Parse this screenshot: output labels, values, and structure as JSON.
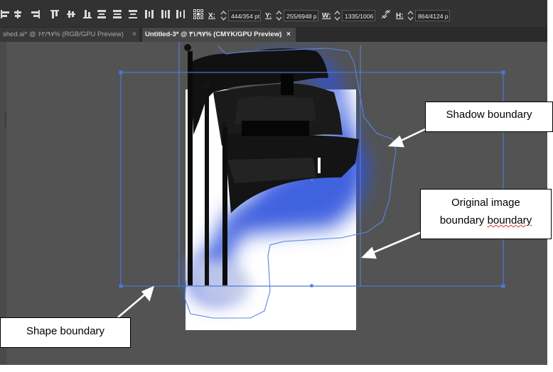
{
  "toolbar": {
    "align_icons": [
      "align-left-icon",
      "align-horizontal-center-icon",
      "align-right-icon",
      "align-top-icon",
      "align-vertical-center-icon",
      "align-bottom-icon",
      "distribute-top-icon",
      "distribute-vertical-center-icon",
      "distribute-bottom-icon",
      "distribute-left-icon",
      "distribute-horizontal-center-icon",
      "distribute-right-icon"
    ],
    "reference_point_icon": "reference-point-icon",
    "x_label": "X:",
    "x_value": "444/354 pt",
    "y_label": "Y:",
    "y_value": "255/6948 p",
    "w_label": "W:",
    "w_value": "1335/1006",
    "link_icon": "constrain-proportions-icon",
    "h_label": "H:",
    "h_value": "864/4124 p"
  },
  "tabs": [
    {
      "label": "shed.ai* @ ۶۲/۹۷% (RGB/GPU Preview)",
      "close": "×",
      "active": false
    },
    {
      "label": "Untitled-3* @ ۳۱/۹۷% (CMYK/GPU Preview)",
      "close": "×",
      "active": true
    }
  ],
  "callouts": {
    "shadow": "Shadow boundary",
    "original_line1": "Original image",
    "original_word1": "boundary",
    "original_word2": "boundary",
    "shape": "Shape boundary"
  },
  "colors": {
    "canvas_bg": "#535353",
    "selection_blue": "#4a78d8",
    "shadow_blue": "#2e52d9",
    "flag_black": "#0c0c0c",
    "artboard": "#ffffff"
  }
}
